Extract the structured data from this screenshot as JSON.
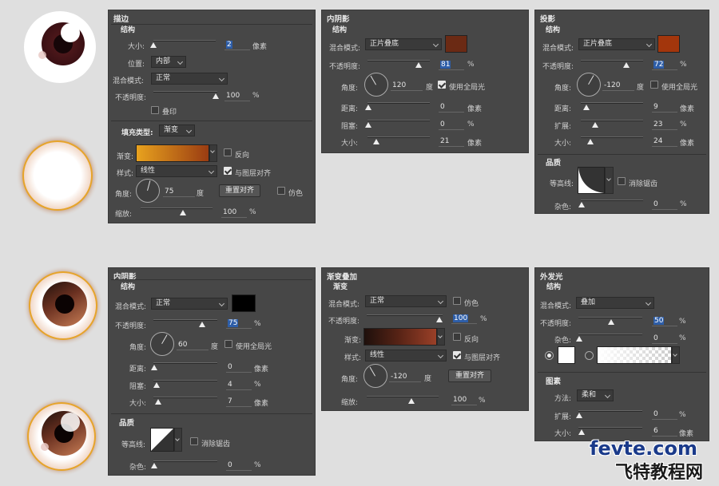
{
  "stroke_panel": {
    "title": "描边",
    "section": "结构",
    "size_label": "大小:",
    "size_value": "2",
    "size_unit": "像素",
    "position_label": "位置:",
    "position_value": "内部",
    "blend_label": "混合模式:",
    "blend_value": "正常",
    "opacity_label": "不透明度:",
    "opacity_value": "100",
    "opacity_unit": "%",
    "overprint_label": "叠印",
    "fill_type_label": "填充类型:",
    "fill_type_value": "渐变",
    "gradient_label": "渐变:",
    "reverse_label": "反向",
    "style_label": "样式:",
    "style_value": "线性",
    "align_label": "与图层对齐",
    "angle_label": "角度:",
    "angle_value": "75",
    "angle_unit": "度",
    "reset_label": "重置对齐",
    "dither_label": "仿色",
    "scale_label": "缩放:",
    "scale_value": "100",
    "scale_unit": "%",
    "gradient_colors": [
      "#e8a21e",
      "#9a3c12"
    ]
  },
  "inner_shadow_1": {
    "title": "内阴影",
    "section": "结构",
    "blend_label": "混合模式:",
    "blend_value": "正片叠底",
    "color": "#6b2a14",
    "opacity_label": "不透明度:",
    "opacity_value": "81",
    "opacity_unit": "%",
    "angle_label": "角度:",
    "angle_value": "120",
    "angle_unit": "度",
    "global_label": "使用全局光",
    "distance_label": "距离:",
    "distance_value": "0",
    "distance_unit": "像素",
    "choke_label": "阻塞:",
    "choke_value": "0",
    "choke_unit": "%",
    "size_label": "大小:",
    "size_value": "21",
    "size_unit": "像素"
  },
  "drop_shadow": {
    "title": "投影",
    "section": "结构",
    "blend_label": "混合模式:",
    "blend_value": "正片叠底",
    "color": "#a3360c",
    "opacity_label": "不透明度:",
    "opacity_value": "72",
    "opacity_unit": "%",
    "angle_label": "角度:",
    "angle_value": "-120",
    "angle_unit": "度",
    "global_label": "使用全局光",
    "distance_label": "距离:",
    "distance_value": "9",
    "distance_unit": "像素",
    "spread_label": "扩展:",
    "spread_value": "23",
    "spread_unit": "%",
    "size_label": "大小:",
    "size_value": "24",
    "size_unit": "像素",
    "quality": "品质",
    "contour_label": "等高线:",
    "antialias_label": "消除锯齿",
    "noise_label": "杂色:",
    "noise_value": "0",
    "noise_unit": "%"
  },
  "inner_shadow_2": {
    "title": "内阴影",
    "section": "结构",
    "blend_label": "混合模式:",
    "blend_value": "正常",
    "color": "#000000",
    "opacity_label": "不透明度:",
    "opacity_value": "75",
    "opacity_unit": "%",
    "angle_label": "角度:",
    "angle_value": "60",
    "angle_unit": "度",
    "global_label": "使用全局光",
    "distance_label": "距离:",
    "distance_value": "0",
    "distance_unit": "像素",
    "choke_label": "阻塞:",
    "choke_value": "4",
    "choke_unit": "%",
    "size_label": "大小:",
    "size_value": "7",
    "size_unit": "像素",
    "quality": "品质",
    "contour_label": "等高线:",
    "antialias_label": "消除锯齿",
    "noise_label": "杂色:",
    "noise_value": "0",
    "noise_unit": "%"
  },
  "gradient_overlay": {
    "title": "渐变叠加",
    "section": "渐变",
    "blend_label": "混合模式:",
    "blend_value": "正常",
    "dither_label": "仿色",
    "opacity_label": "不透明度:",
    "opacity_value": "100",
    "opacity_unit": "%",
    "gradient_label": "渐变:",
    "reverse_label": "反向",
    "style_label": "样式:",
    "style_value": "线性",
    "align_label": "与图层对齐",
    "angle_label": "角度:",
    "angle_value": "-120",
    "angle_unit": "度",
    "reset_label": "重置对齐",
    "scale_label": "缩放:",
    "scale_value": "100",
    "scale_unit": "%",
    "gradient_colors": [
      "#1e100c",
      "#5a2416",
      "#9a4028"
    ]
  },
  "outer_glow": {
    "title": "外发光",
    "section": "结构",
    "blend_label": "混合模式:",
    "blend_value": "叠加",
    "opacity_label": "不透明度:",
    "opacity_value": "50",
    "opacity_unit": "%",
    "noise_label": "杂色:",
    "noise_value": "0",
    "noise_unit": "%",
    "elements": "图素",
    "method_label": "方法:",
    "method_value": "柔和",
    "spread_label": "扩展:",
    "spread_value": "0",
    "spread_unit": "%",
    "size_label": "大小:",
    "size_value": "6",
    "size_unit": "像素"
  },
  "watermark": {
    "line1": "fevte.com",
    "line2": "飞特教程网"
  }
}
